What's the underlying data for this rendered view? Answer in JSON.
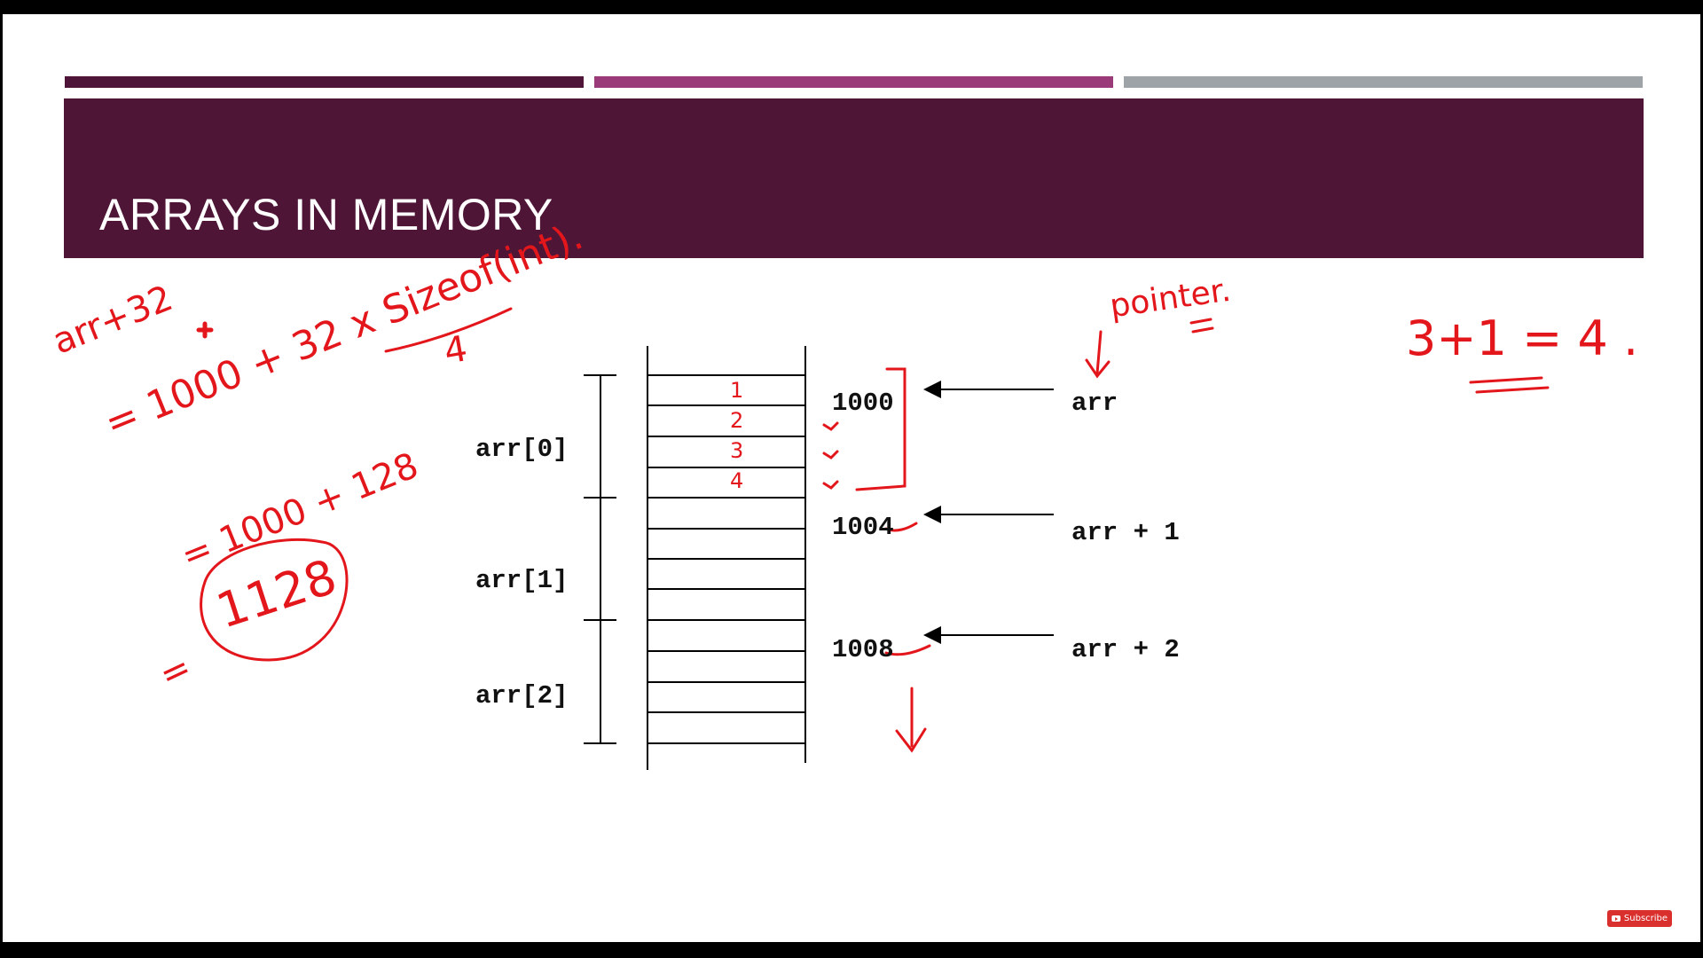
{
  "slide": {
    "title": "ARRAYS IN MEMORY",
    "colors": {
      "title_band": "#4e1537",
      "bar_1": "#4f1538",
      "bar_2": "#9a3a79",
      "bar_3": "#9ea3a8",
      "annotation_ink": "#e3161b"
    }
  },
  "diagram": {
    "elements": [
      {
        "label": "arr[0]",
        "address": "1000",
        "pointer": "arr"
      },
      {
        "label": "arr[1]",
        "address": "1004",
        "pointer": "arr + 1"
      },
      {
        "label": "arr[2]",
        "address": "1008",
        "pointer": "arr + 2"
      }
    ],
    "bytes_per_element": 4
  },
  "annotations": {
    "expr_1": "arr+32",
    "expr_2": "= 1000 + 32 x Sizeof(int).",
    "sizeof_value": "4",
    "expr_3": "= 1000 + 128",
    "result": "1128",
    "equals": "=",
    "pointer_note": "pointer.",
    "sum_note": "3+1 = 4 .",
    "byte_numbers": [
      "1",
      "2",
      "3",
      "4"
    ]
  },
  "badge": {
    "label": "Subscribe",
    "icon": "youtube-play-icon"
  }
}
